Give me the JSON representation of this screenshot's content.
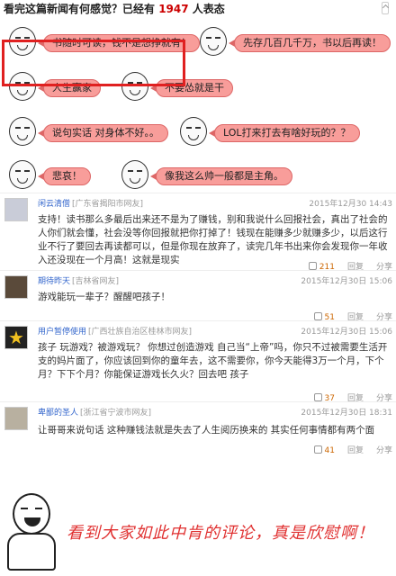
{
  "header": {
    "prefix": "看完这篇新闻有何感觉？已经有 ",
    "count": "1947",
    "suffix": " 人表态"
  },
  "votes": [
    {
      "label": "书随时可读，钱不是想挣就有！"
    },
    {
      "label": "先存几百几千万，书以后再读！"
    },
    {
      "label": "人生赢家"
    },
    {
      "label": "不要怂就是干"
    },
    {
      "label": "说句实话 对身体不好。。"
    },
    {
      "label": "LOL打来打去有啥好玩的？？"
    },
    {
      "label": "悲哀！"
    },
    {
      "label": "像我这么帅一般都是主角。"
    }
  ],
  "comments": [
    {
      "user": "闲云清僧",
      "location": "[广东省揭阳市网友]",
      "time": "2015年12月30 14:43",
      "text": "支持！读书那么多最后出来还不是为了赚钱，别和我说什么回报社会，真出了社会的人你们就会懂，社会没等你回报就把你打掉了！钱现在能赚多少就赚多少，以后这行业不行了要回去再读都可以，但是你现在放弃了，读完几年书出来你会发现你一年收入还没现在一个月高！这就是现实",
      "likes": "211",
      "reply": "回复",
      "share": "分享"
    },
    {
      "user": "期待昨天",
      "location": "[吉林省网友]",
      "time": "2015年12月30日 15:06",
      "text": "游戏能玩一辈子？醒醒吧孩子！",
      "likes": "51",
      "reply": "回复",
      "share": "分享"
    },
    {
      "user": "用户暂停使用",
      "location": "[广西壮族自治区桂林市网友]",
      "time": "2015年12月30日 15:06",
      "text": "孩子 玩游戏？被游戏玩？ 你想过创造游戏 自己当“上帝”吗，你只不过被需要生活开支的妈片面了，你应该回到你的童年去，这不需要你，你今天能得3万一个月，下个月？下下个月？你能保证游戏长久火？回去吧 孩子",
      "likes": "37",
      "reply": "回复",
      "share": "分享"
    },
    {
      "user": "卑鄙的圣人",
      "location": "[浙江省宁波市网友]",
      "time": "2015年12月30日 18:31",
      "text": "让哥哥来说句话 这种赚钱法就是失去了人生阅历换来的 其实任何事情都有两个面",
      "likes": "41",
      "reply": "回复",
      "share": "分享"
    }
  ],
  "footer": {
    "caption": "看到大家如此中肯的评论，真是欣慰啊！"
  }
}
